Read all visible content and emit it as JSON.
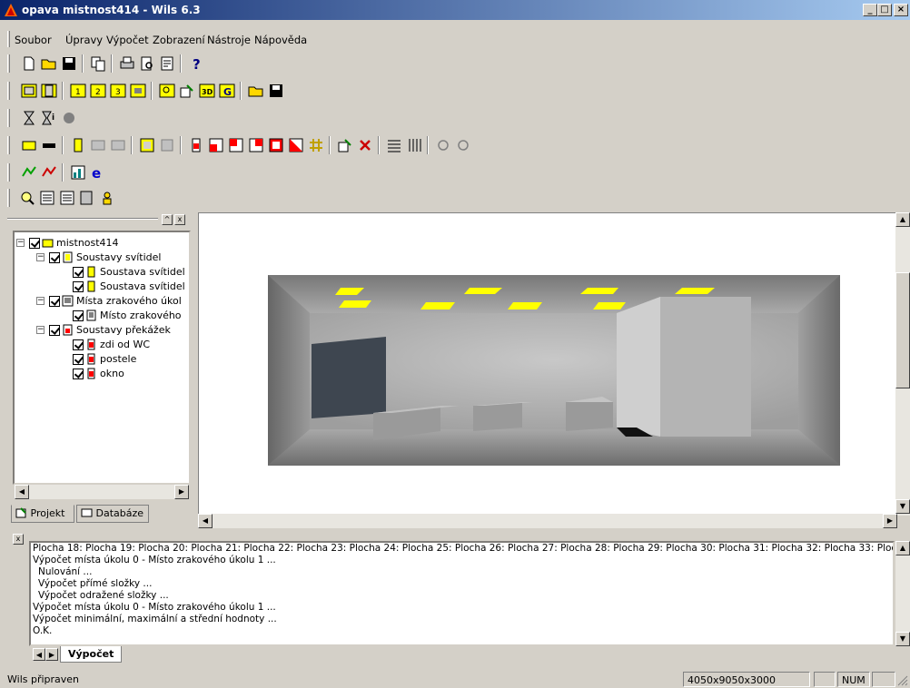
{
  "window": {
    "title": "opava mistnost414 - Wils 6.3",
    "min_label": "_",
    "max_label": "□",
    "close_label": "×"
  },
  "menu": [
    "Soubor",
    "Úpravy",
    "Výpočet",
    "Zobrazení",
    "Nástroje",
    "Nápověda"
  ],
  "tree": {
    "items": [
      {
        "label": "mistnost414",
        "level": 0,
        "icon": "room-icon"
      },
      {
        "label": "Soustavy svítidel",
        "level": 1,
        "icon": "luminaire-group-icon"
      },
      {
        "label": "Soustava svítidel",
        "level": 2,
        "icon": "luminaire-icon"
      },
      {
        "label": "Soustava svítidel",
        "level": 2,
        "icon": "luminaire-icon"
      },
      {
        "label": "Místa zrakového úkol",
        "level": 1,
        "icon": "task-area-group-icon"
      },
      {
        "label": "Místo zrakového",
        "level": 2,
        "icon": "task-area-icon"
      },
      {
        "label": "Soustavy překážek",
        "level": 1,
        "icon": "obstacle-group-icon"
      },
      {
        "label": "zdi od WC",
        "level": 2,
        "icon": "obstacle-icon"
      },
      {
        "label": "postele",
        "level": 2,
        "icon": "obstacle-icon"
      },
      {
        "label": "okno",
        "level": 2,
        "icon": "obstacle-icon"
      }
    ]
  },
  "tabs": {
    "project": "Projekt",
    "database": "Databáze"
  },
  "log": {
    "lines": [
      "Plocha 18: Plocha 19: Plocha 20: Plocha 21: Plocha 22: Plocha 23: Plocha 24: Plocha 25: Plocha 26: Plocha 27: Plocha 28: Plocha 29: Plocha 30: Plocha 31: Plocha 32: Plocha 33: Plocha 3",
      "Výpočet místa úkolu 0 - Místo zrakového úkolu 1 ...",
      "   Nulování ...",
      "   Výpočet přímé složky ...",
      "   Výpočet odražené složky ...",
      "Výpočet místa úkolu 0 - Místo zrakového úkolu 1 ...",
      "Výpočet minimální, maximální a střední hodnoty ...",
      "O.K."
    ],
    "tab": "Výpočet"
  },
  "status": {
    "text": "Wils připraven",
    "dimensions": "4050x9050x3000",
    "num": "NUM"
  },
  "colors": {
    "title_start": "#0a246a",
    "title_end": "#a6caf0",
    "face": "#d4d0c8",
    "light": "#ffff00"
  }
}
